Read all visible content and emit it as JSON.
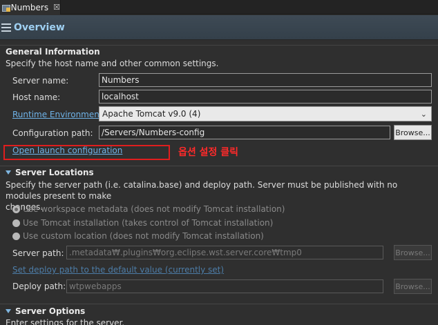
{
  "tab": {
    "label": "Numbers",
    "close": "☒"
  },
  "header": {
    "title": "Overview"
  },
  "general": {
    "title": "General Information",
    "description": "Specify the host name and other common settings.",
    "server_name_label": "Server name:",
    "server_name_value": "Numbers",
    "host_name_label": "Host name:",
    "host_name_value": "localhost",
    "runtime_label": "Runtime Environment:",
    "runtime_value": "Apache Tomcat v9.0 (4)",
    "config_path_label": "Configuration path:",
    "config_path_value": "/Servers/Numbers-config",
    "browse_label": "Browse...",
    "open_launch_label": "Open launch configuration"
  },
  "annotation": {
    "text": "옵션 설정 클릭",
    "color": "#ff2a2a"
  },
  "locations": {
    "title": "Server Locations",
    "description_line1": "Specify the server path (i.e. catalina.base) and deploy path. Server must be published with no modules present to make",
    "description_line2": "changes.",
    "radio_workspace": "Use workspace metadata (does not modify Tomcat installation)",
    "radio_tomcat": "Use Tomcat installation (takes control of Tomcat installation)",
    "radio_custom": "Use custom location (does not modify Tomcat installation)",
    "selected_radio": "workspace",
    "server_path_label": "Server path:",
    "server_path_value": ".metadata₩.plugins₩org.eclipse.wst.server.core₩tmp0",
    "set_deploy_link": "Set deploy path to the default value (currently set)",
    "deploy_path_label": "Deploy path:",
    "deploy_path_value": "wtpwebapps",
    "browse_label": "Browse..."
  },
  "options": {
    "title": "Server Options",
    "description": "Enter settings for the server."
  },
  "colors": {
    "accent": "#9fd0f2",
    "link": "#6fb3e8",
    "background": "#2f2f2f"
  }
}
